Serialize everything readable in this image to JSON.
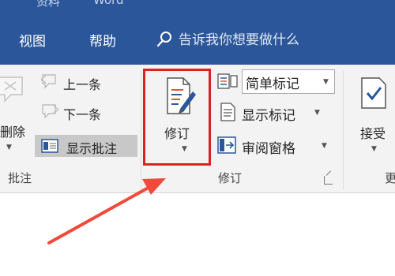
{
  "title_bar": {
    "left_text": "资料",
    "right_text": "Word"
  },
  "tabs": [
    {
      "label": "视图"
    },
    {
      "label": "帮助"
    }
  ],
  "tell_me": {
    "placeholder": "告诉我你想要做什么"
  },
  "ribbon": {
    "comments_group": {
      "label": "批注",
      "delete_label": "删除",
      "previous_label": "上一条",
      "next_label": "下一条",
      "show_comments_label": "显示批注"
    },
    "tracking_group": {
      "label": "修订",
      "track_changes_label": "修订",
      "markup_select_value": "简单标记",
      "show_markup_label": "显示标记",
      "reviewing_pane_label": "审阅窗格"
    },
    "changes_group": {
      "accept_label": "接受",
      "label_partial": "更"
    }
  },
  "colors": {
    "title_bar": "#2b579a",
    "highlight_box": "#e02020",
    "annotation_arrow": "#f04a3b"
  },
  "icons": [
    "search-icon",
    "delete-comment-icon",
    "previous-comment-icon",
    "next-comment-icon",
    "show-comments-icon",
    "track-changes-icon",
    "markup-icon",
    "show-markup-icon",
    "reviewing-pane-icon",
    "accept-icon",
    "dialog-launcher-icon",
    "red-arrow"
  ]
}
